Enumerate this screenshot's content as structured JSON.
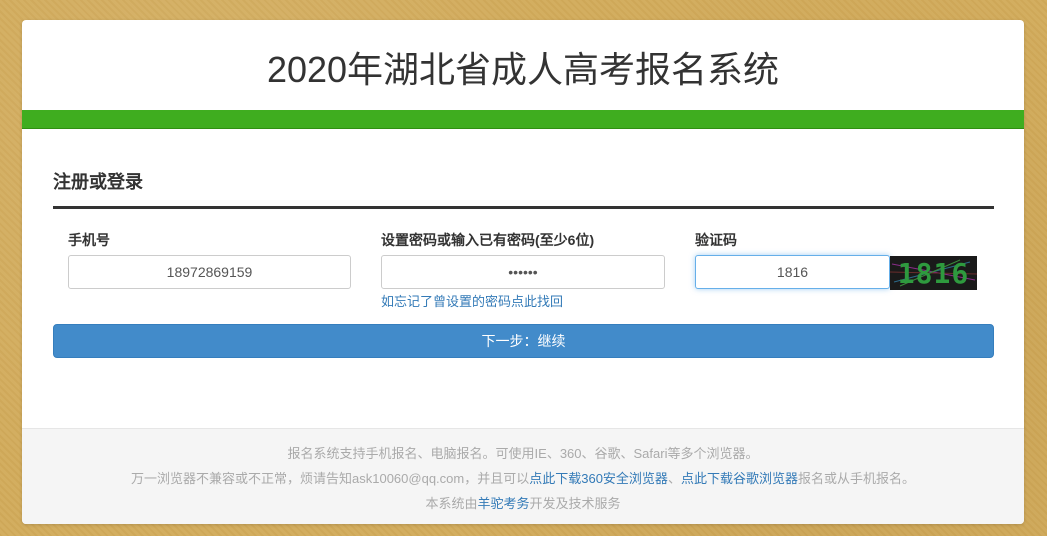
{
  "header": {
    "title": "2020年湖北省成人高考报名系统"
  },
  "form": {
    "section_title": "注册或登录",
    "phone": {
      "label": "手机号",
      "value": "18972869159"
    },
    "password": {
      "label": "设置密码或输入已有密码(至少6位)",
      "value": "••••••",
      "help_link": "如忘记了曾设置的密码点此找回"
    },
    "captcha": {
      "label": "验证码",
      "value": "1816",
      "image_text": "1816"
    },
    "submit_label": "下一步：继续"
  },
  "footer": {
    "line1": "报名系统支持手机报名、电脑报名。可使用IE、360、谷歌、Safari等多个浏览器。",
    "line2_prefix": "万一浏览器不兼容或不正常，烦请告知ask10060@qq.com，并且可以",
    "line2_link1": "点此下载360安全浏览器",
    "line2_sep": "、",
    "line2_link2": "点此下载谷歌浏览器",
    "line2_suffix": "报名或从手机报名。",
    "line3_prefix": "本系统由",
    "line3_link": "羊驼考务",
    "line3_suffix": "开发及技术服务"
  },
  "colors": {
    "background": "#d2ab5b",
    "green_bar": "#3fad1f",
    "primary_button": "#428bca",
    "link": "#337ab7"
  }
}
